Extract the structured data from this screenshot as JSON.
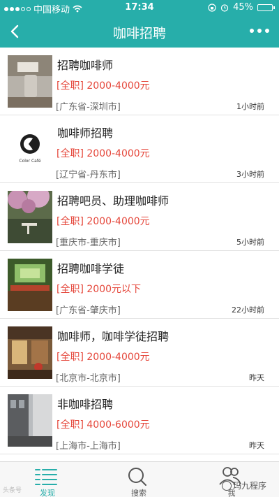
{
  "status_bar": {
    "carrier": "中国移动",
    "time": "17:34",
    "battery": "45%",
    "battery_level": 0.45
  },
  "nav": {
    "title": "咖啡招聘"
  },
  "jobs": [
    {
      "title": "招聘咖啡师",
      "salary": "[全职] 2000-4000元",
      "location": "[广东省-深圳市]",
      "time": "1小时前"
    },
    {
      "title": "咖啡师招聘",
      "salary": "[全职] 2000-4000元",
      "location": "[辽宁省-丹东市]",
      "time": "3小时前",
      "logo_text": "Color Café"
    },
    {
      "title": "招聘吧员、助理咖啡师",
      "salary": "[全职] 2000-4000元",
      "location": "[重庆市-重庆市]",
      "time": "5小时前"
    },
    {
      "title": "招聘咖啡学徒",
      "salary": "[全职] 2000元以下",
      "location": "[广东省-肇庆市]",
      "time": "22小时前"
    },
    {
      "title": "咖啡师，咖啡学徒招聘",
      "salary": "[全职] 2000-4000元",
      "location": "[北京市-北京市]",
      "time": "昨天"
    },
    {
      "title": "非咖啡招聘",
      "salary": "[全职] 4000-6000元",
      "location": "[上海市-上海市]",
      "time": "昨天"
    }
  ],
  "tabs": [
    {
      "label": "发现",
      "icon": "discover-list-icon"
    },
    {
      "label": "搜索",
      "icon": "search-icon"
    },
    {
      "label": "我",
      "icon": "user-icon"
    }
  ],
  "watermark": {
    "left": "头条号",
    "right": "玛九程序"
  },
  "colors": {
    "accent": "#27aeaa",
    "salary": "#e5473b"
  }
}
